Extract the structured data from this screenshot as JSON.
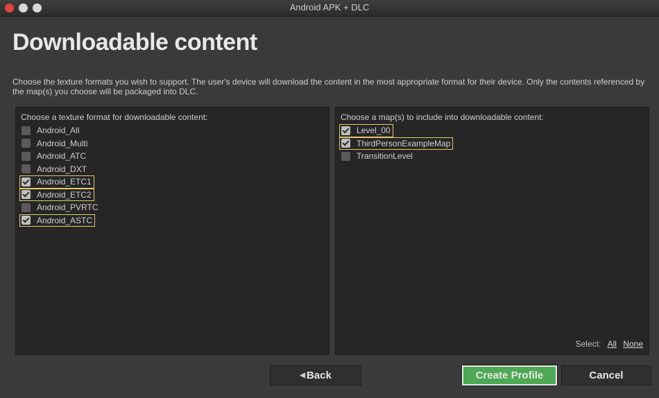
{
  "window": {
    "title": "Android APK + DLC"
  },
  "page": {
    "heading": "Downloadable content",
    "description": "Choose the texture formats you wish to support. The user's device will download the content in the most appropriate format for their device. Only the contents referenced by the map(s) you choose will be packaged into DLC."
  },
  "texture_panel": {
    "label": "Choose a texture format for downloadable content:",
    "items": [
      {
        "label": "Android_All",
        "checked": false
      },
      {
        "label": "Android_Multi",
        "checked": false
      },
      {
        "label": "Android_ATC",
        "checked": false
      },
      {
        "label": "Android_DXT",
        "checked": false
      },
      {
        "label": "Android_ETC1",
        "checked": true
      },
      {
        "label": "Android_ETC2",
        "checked": true
      },
      {
        "label": "Android_PVRTC",
        "checked": false
      },
      {
        "label": "Android_ASTC",
        "checked": true
      }
    ]
  },
  "map_panel": {
    "label": "Choose a map(s) to include into downloadable content:",
    "items": [
      {
        "label": "Level_00",
        "checked": true
      },
      {
        "label": "ThirdPersonExampleMap",
        "checked": true
      },
      {
        "label": "TransitionLevel",
        "checked": false
      }
    ],
    "select_label": "Select:",
    "select_all": "All",
    "select_none": "None"
  },
  "buttons": {
    "back": "Back",
    "create": "Create Profile",
    "cancel": "Cancel"
  },
  "colors": {
    "accent_green": "#4ea954",
    "highlight_border": "#e8c96b",
    "close_red": "#e0443e"
  }
}
